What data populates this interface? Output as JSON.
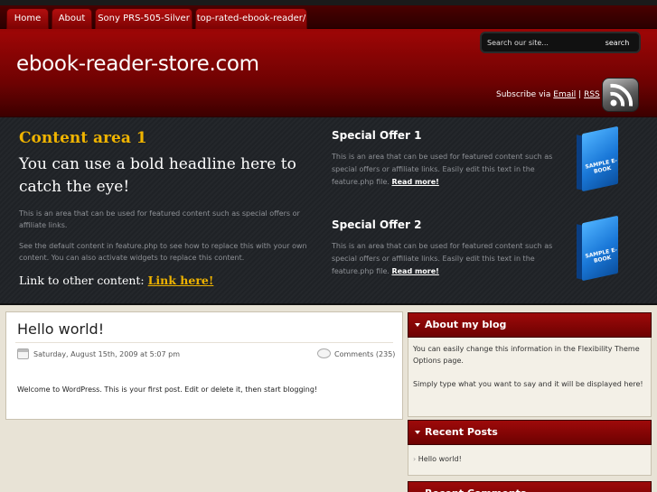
{
  "nav": {
    "tabs": [
      "Home",
      "About",
      "Sony PRS-505-Silver",
      "top-rated-ebook-reader/"
    ]
  },
  "header": {
    "site_title": "ebook-reader-store.com",
    "search": {
      "placeholder": "Search our site...",
      "button_label": "search"
    },
    "subscribe": {
      "prefix": "Subscribe via",
      "email_link": "Email",
      "separator": "|",
      "rss_link": "RSS"
    }
  },
  "feature": {
    "content_area_title": "Content area 1",
    "headline": "You can use a bold headline here to catch the eye!",
    "paragraph1": "This is an area that can be used for featured content such as special offers or affiliate links.",
    "paragraph2": "See the default content in feature.php to see how to replace this with your own content. You can also activate widgets to replace this content.",
    "link_prefix": "Link to other content:",
    "link_label": "Link here!",
    "offers": [
      {
        "title": "Special Offer 1",
        "text": "This is an area that can be used for featured content such as special offers or affiliate links. Easily edit this text in the feature.php file.",
        "link": "Read more!",
        "ebook_label": "SAMPLE E-BOOK"
      },
      {
        "title": "Special Offer 2",
        "text": "This is an area that can be used for featured content such as special offers or affiliate links. Easily edit this text in the feature.php file.",
        "link": "Read more!",
        "ebook_label": "SAMPLE E-BOOK"
      }
    ]
  },
  "post": {
    "title": "Hello world!",
    "date": "Saturday, August 15th, 2009 at 5:07 pm",
    "comments": "Comments (235)",
    "body": "Welcome to WordPress. This is your first post. Edit or delete it, then start blogging!"
  },
  "sidebar": {
    "about": {
      "title": "About my blog",
      "text1": "You can easily change this information in the Flexibility Theme Options page.",
      "text2": "Simply type what you want to say and it will be displayed here!"
    },
    "recent_posts": {
      "title": "Recent Posts",
      "items": [
        "Hello world!"
      ]
    },
    "recent_comments": {
      "title": "Recent Comments"
    }
  },
  "colors": {
    "header_red": "#9c0606",
    "accent_gold": "#f0b400",
    "feature_dark": "#24272b",
    "page_bg": "#e8e3d6"
  }
}
